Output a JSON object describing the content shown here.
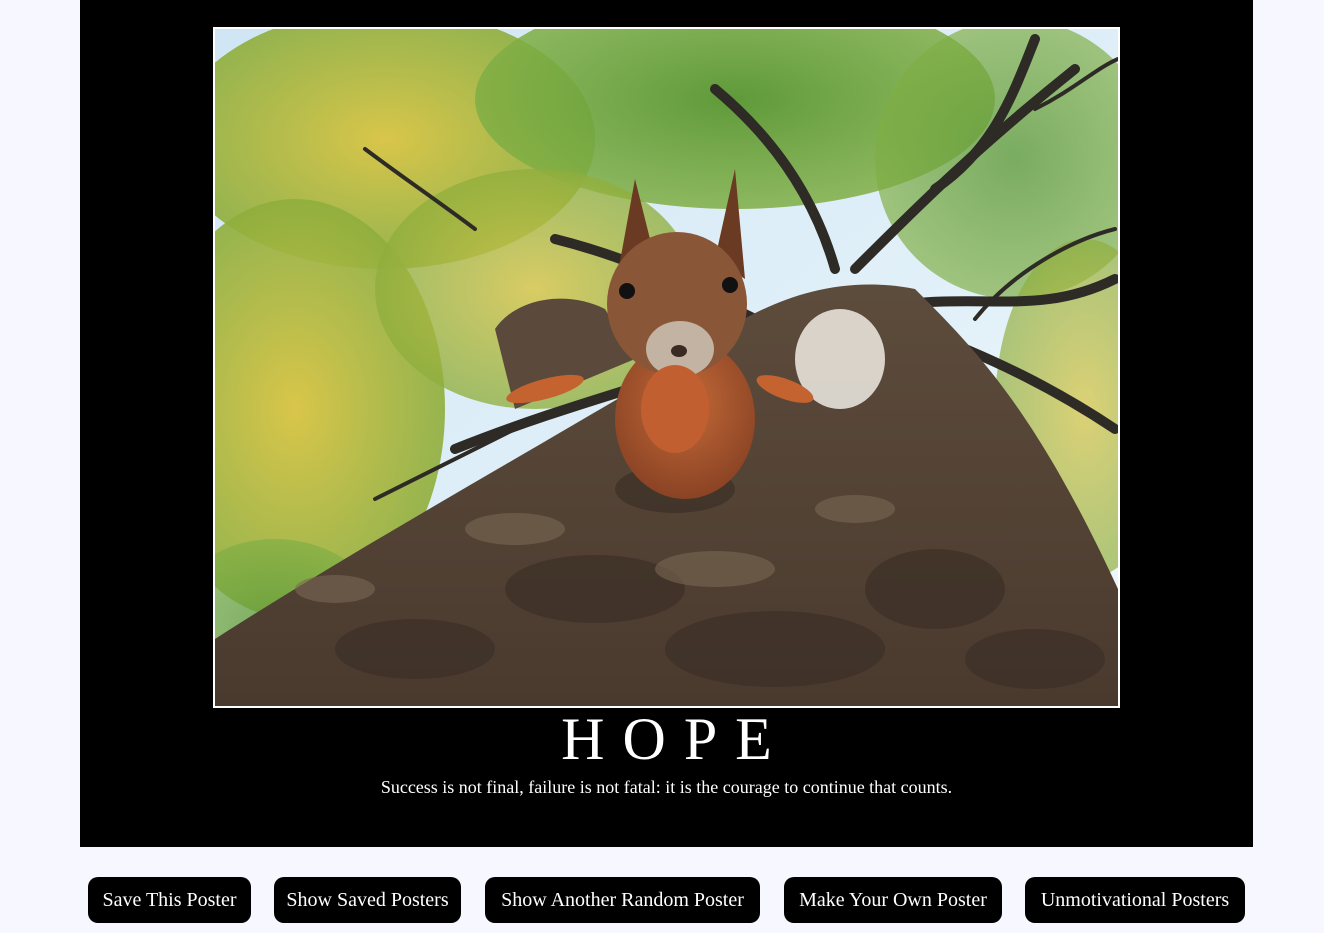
{
  "poster": {
    "title": "HOPE",
    "quote": "Success is not final, failure is not fatal: it is the courage to continue that counts.",
    "image_icon": "squirrel-on-tree-photo"
  },
  "buttons": {
    "save": "Save This Poster",
    "show_saved": "Show Saved Posters",
    "random": "Show Another Random Poster",
    "make_own": "Make Your Own Poster",
    "unmotivational": "Unmotivational Posters"
  },
  "colors": {
    "page_background": "#f7f7ff",
    "poster_background": "#000000",
    "button_background": "#000000",
    "text": "#ffffff"
  }
}
